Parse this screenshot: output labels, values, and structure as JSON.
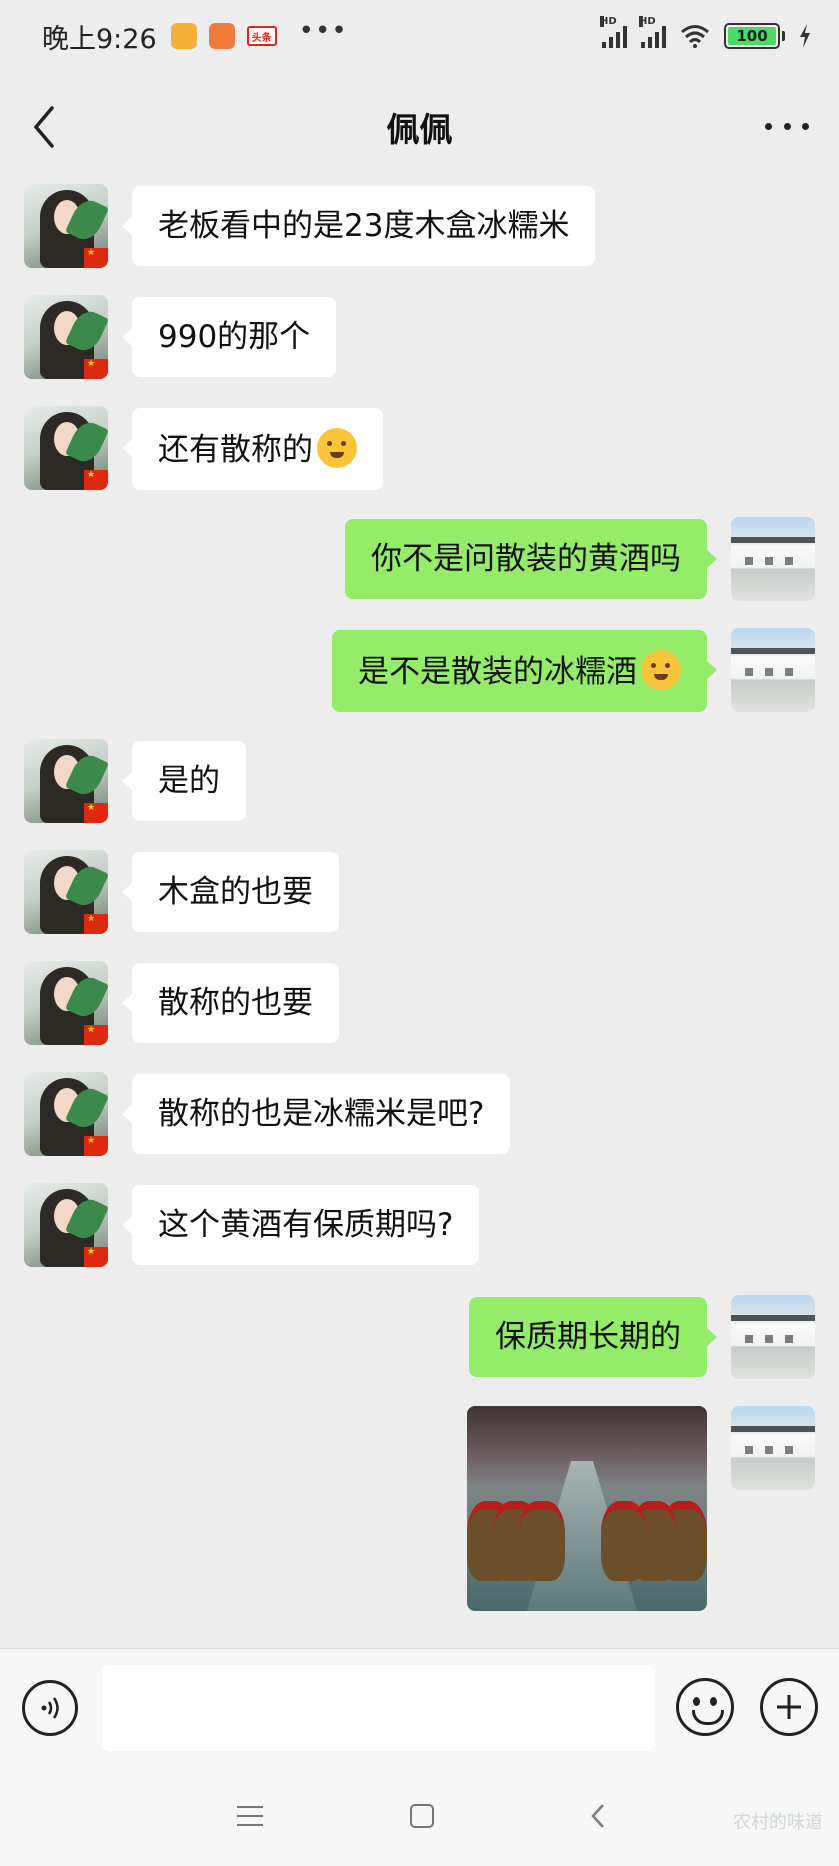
{
  "status_bar": {
    "time": "晚上9:26",
    "app_badge": "头条",
    "dots": "•••",
    "signal_label": "HD",
    "battery": "100"
  },
  "header": {
    "title": "佩佩"
  },
  "messages": [
    {
      "side": "left",
      "text": "老板看中的是23度木盒冰糯米"
    },
    {
      "side": "left",
      "text": "990的那个"
    },
    {
      "side": "left",
      "text": "还有散称的",
      "emoji": "thinking-emoji"
    },
    {
      "side": "right",
      "text": "你不是问散装的黄酒吗"
    },
    {
      "side": "right",
      "text": "是不是散装的冰糯酒",
      "emoji": "confused-emoji"
    },
    {
      "side": "left",
      "text": "是的"
    },
    {
      "side": "left",
      "text": "木盒的也要"
    },
    {
      "side": "left",
      "text": "散称的也要"
    },
    {
      "side": "left",
      "text": "散称的也是冰糯米是吧?"
    },
    {
      "side": "left",
      "text": "这个黄酒有保质期吗?"
    },
    {
      "side": "right",
      "text": "保质期长期的"
    },
    {
      "side": "right",
      "type": "image",
      "image": "wine-cellar-photo"
    }
  ],
  "input": {
    "placeholder": ""
  },
  "watermark": "农村的味道"
}
